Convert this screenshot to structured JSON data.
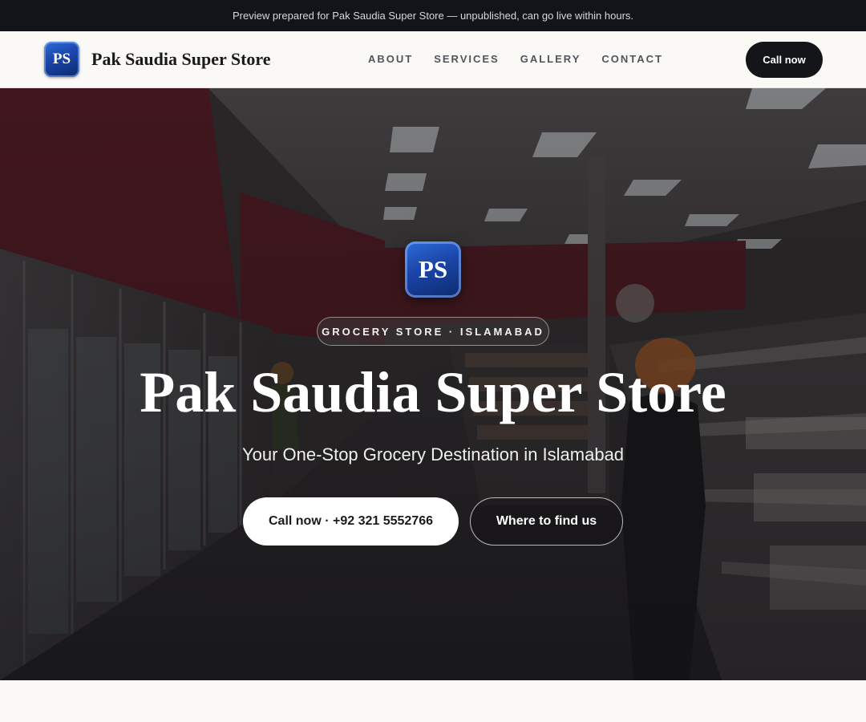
{
  "announcement": {
    "text": "Preview prepared for Pak Saudia Super Store — unpublished, can go live within hours."
  },
  "header": {
    "logo_initials": "PS",
    "brand_name": "Pak Saudia Super Store",
    "nav": [
      {
        "label": "ABOUT"
      },
      {
        "label": "SERVICES"
      },
      {
        "label": "GALLERY"
      },
      {
        "label": "CONTACT"
      }
    ],
    "call_button": "Call now"
  },
  "hero": {
    "logo_initials": "PS",
    "tag": "GROCERY STORE · ISLAMABAD",
    "title": "Pak Saudia Super Store",
    "subtitle": "Your One-Stop Grocery Destination in Islamabad",
    "primary_button": "Call now · +92 321 5552766",
    "secondary_button": "Where to find us"
  },
  "colors": {
    "logo_blue": "#1a45a8",
    "dark": "#131519",
    "page_bg": "#faf9f6"
  }
}
